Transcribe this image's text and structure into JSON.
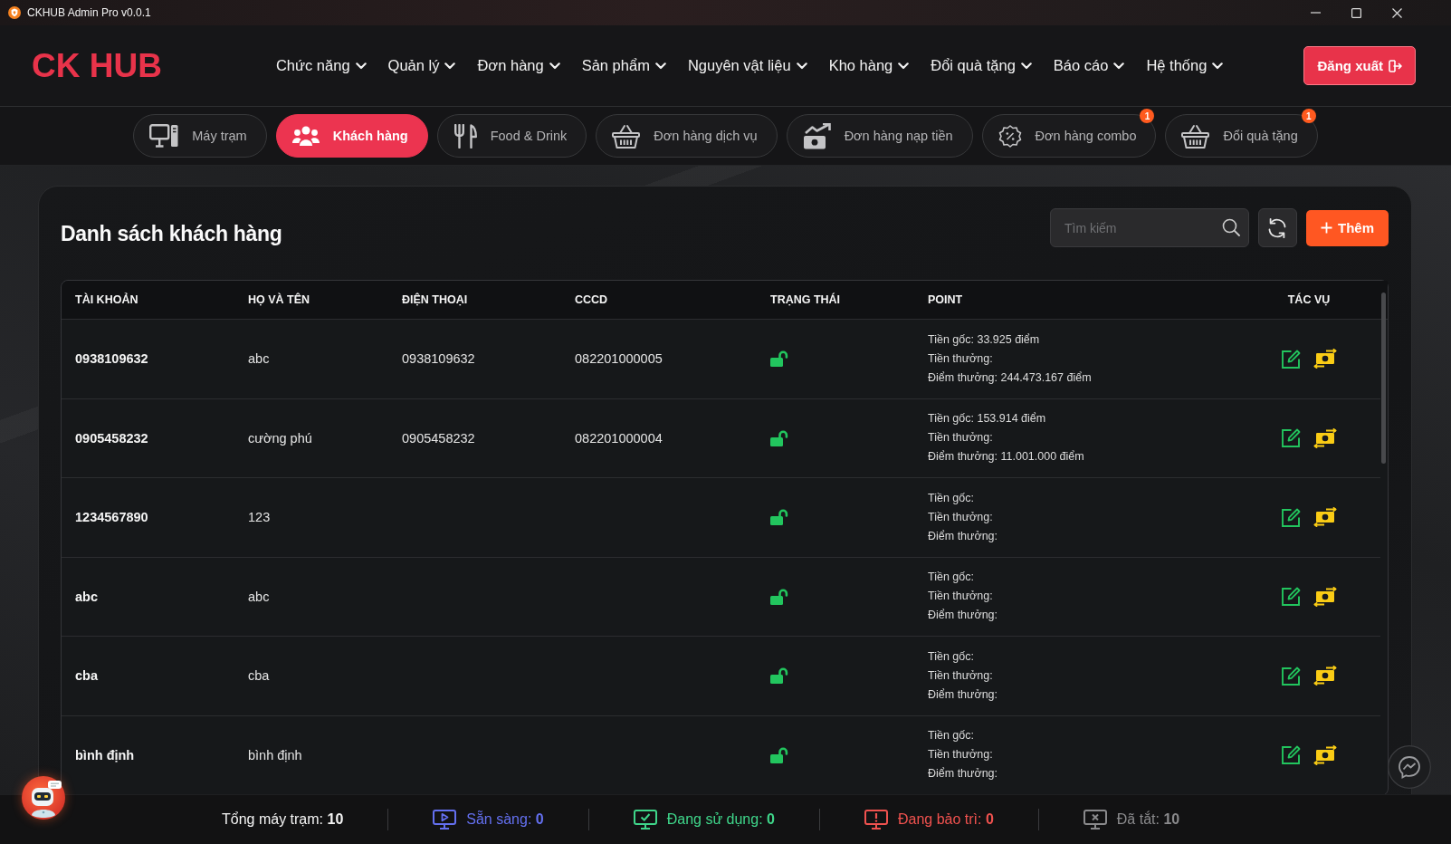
{
  "window": {
    "title": "CKHUB Admin Pro v0.0.1"
  },
  "header": {
    "logo": "CK HUB",
    "nav": [
      "Chức năng",
      "Quản lý",
      "Đơn hàng",
      "Sản phẩm",
      "Nguyên vật liệu",
      "Kho hàng",
      "Đổi quà tặng",
      "Báo cáo",
      "Hệ thống"
    ],
    "logout": "Đăng xuất"
  },
  "tabs": [
    {
      "label": "Máy trạm",
      "selected": false
    },
    {
      "label": "Khách hàng",
      "selected": true
    },
    {
      "label": "Food & Drink",
      "selected": false
    },
    {
      "label": "Đơn hàng dịch vụ",
      "selected": false
    },
    {
      "label": "Đơn hàng nạp tiền",
      "selected": false
    },
    {
      "label": "Đơn hàng combo",
      "selected": false,
      "badge": "1"
    },
    {
      "label": "Đổi quà tặng",
      "selected": false,
      "badge": "1"
    }
  ],
  "customers": {
    "title": "Danh sách khách hàng",
    "search": {
      "placeholder": "Tìm kiếm"
    },
    "add_button": "Thêm",
    "table": {
      "columns": [
        "TÀI KHOẢN",
        "HỌ VÀ TÊN",
        "ĐIỆN THOẠI",
        "CCCD",
        "TRẠNG THÁI",
        "POINT",
        "TÁC VỤ"
      ],
      "rows": [
        {
          "account": "0938109632",
          "name": "abc",
          "phone": "0938109632",
          "id_card": "082201000005",
          "locked": false,
          "points": [
            "Tiền gốc: 33.925 điểm",
            "Tiền thưởng:",
            "Điểm thưởng: 244.473.167 điểm"
          ]
        },
        {
          "account": "0905458232",
          "name": "cường phú",
          "phone": "0905458232",
          "id_card": "082201000004",
          "locked": false,
          "points": [
            "Tiền gốc: 153.914 điểm",
            "Tiền thưởng:",
            "Điểm thưởng: 11.001.000 điểm"
          ]
        },
        {
          "account": "1234567890",
          "name": "123",
          "locked": false,
          "points": [
            "Tiền gốc:",
            "Tiền thưởng:",
            "Điểm thưởng:"
          ]
        },
        {
          "account": "abc",
          "name": "abc",
          "locked": false,
          "points": [
            "Tiền gốc:",
            "Tiền thưởng:",
            "Điểm thưởng:"
          ]
        },
        {
          "account": "cba",
          "name": "cba",
          "locked": false,
          "points": [
            "Tiền gốc:",
            "Tiền thưởng:",
            "Điểm thưởng:"
          ]
        },
        {
          "account": "bình định",
          "name": "bình định",
          "locked": false,
          "points": [
            "Tiền gốc:",
            "Tiền thưởng:",
            "Điểm thưởng:"
          ]
        }
      ]
    }
  },
  "status_bar": {
    "items": [
      {
        "text": "Tổng máy trạm: **10**"
      },
      {
        "text": "Sẵn sàng: **0**",
        "color": "#6470f0"
      },
      {
        "text": "Đang sử dụng: **0**",
        "color": "#3fd68a"
      },
      {
        "text": "Đang bảo trì: **0**",
        "color": "#f0524f"
      },
      {
        "text": "Đã tắt: **10**",
        "color": "#8a8a8c"
      }
    ]
  }
}
